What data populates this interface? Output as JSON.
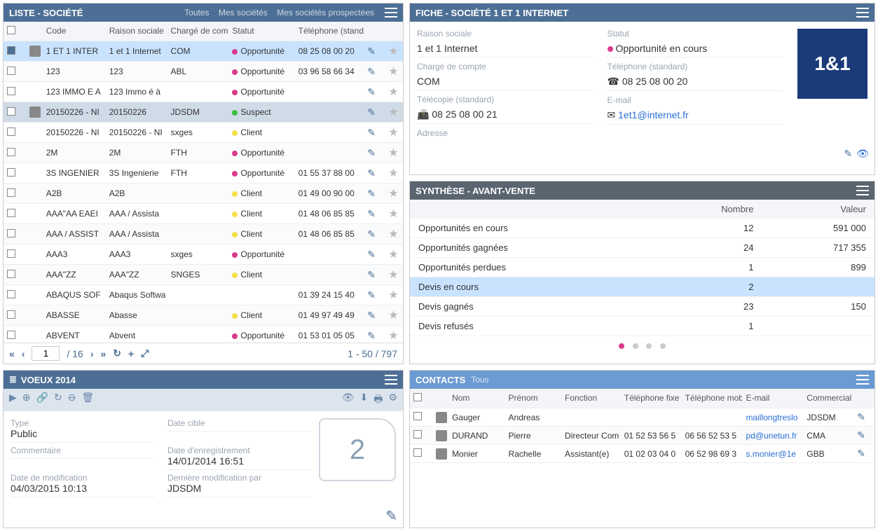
{
  "liste": {
    "title": "LISTE - SOCIÉTÉ",
    "tabs": [
      "Toutes",
      "Mes sociétés",
      "Mes sociétés prospectées"
    ],
    "headers": {
      "code": "Code",
      "raison": "Raison sociale",
      "charge": "Chargé de compte",
      "statut": "Statut",
      "tel": "Téléphone (standard)"
    },
    "rows": [
      {
        "chk": true,
        "logo": true,
        "code": "1 ET 1 INTER",
        "rs": "1 et 1 Internet",
        "cc": "COM",
        "sc": "#d93b8a",
        "stat": "Opportunité",
        "tel": "08 25 08 00 20",
        "sel": true
      },
      {
        "chk": false,
        "logo": false,
        "code": "123",
        "rs": "123",
        "cc": "ABL",
        "sc": "#d93b8a",
        "stat": "Opportunité",
        "tel": "03 96 58 66 34"
      },
      {
        "chk": false,
        "logo": false,
        "code": "123 IMMO E A",
        "rs": "123 Immo é à",
        "cc": "",
        "sc": "#d93b8a",
        "stat": "Opportunité",
        "tel": ""
      },
      {
        "chk": false,
        "logo": true,
        "code": "20150226 - NI",
        "rs": "20150226",
        "cc": "JDSDM",
        "sc": "#3cbf3c",
        "stat": "Suspect",
        "tel": "",
        "alt": true
      },
      {
        "chk": false,
        "logo": false,
        "code": "20150226 - NI",
        "rs": "20150226 - NI",
        "cc": "sxges",
        "sc": "#f5e04a",
        "stat": "Client",
        "tel": ""
      },
      {
        "chk": false,
        "logo": false,
        "code": "2M",
        "rs": "2M",
        "cc": "FTH",
        "sc": "#d93b8a",
        "stat": "Opportunité",
        "tel": ""
      },
      {
        "chk": false,
        "logo": false,
        "code": "3S INGENIER",
        "rs": "3S Ingenierie",
        "cc": "FTH",
        "sc": "#d93b8a",
        "stat": "Opportunité",
        "tel": "01 55 37 88 00"
      },
      {
        "chk": false,
        "logo": false,
        "code": "A2B",
        "rs": "A2B",
        "cc": "",
        "sc": "#f5e04a",
        "stat": "Client",
        "tel": "01 49 00 90 00"
      },
      {
        "chk": false,
        "logo": false,
        "code": "AAA\"AA EAEI",
        "rs": "AAA / Assista",
        "cc": "",
        "sc": "#f5e04a",
        "stat": "Client",
        "tel": "01 48 06 85 85"
      },
      {
        "chk": false,
        "logo": false,
        "code": "AAA / ASSIST",
        "rs": "AAA / Assista",
        "cc": "",
        "sc": "#f5e04a",
        "stat": "Client",
        "tel": "01 48 06 85 85"
      },
      {
        "chk": false,
        "logo": false,
        "code": "AAA3",
        "rs": "AAA3",
        "cc": "sxges",
        "sc": "#d93b8a",
        "stat": "Opportunité",
        "tel": ""
      },
      {
        "chk": false,
        "logo": false,
        "code": "AAA\"ZZ",
        "rs": "AAA\"ZZ",
        "cc": "SNGES",
        "sc": "#f5e04a",
        "stat": "Client",
        "tel": ""
      },
      {
        "chk": false,
        "logo": false,
        "code": "ABAQUS SOF",
        "rs": "Abaqus Softwa",
        "cc": "",
        "sc": "",
        "stat": "",
        "tel": "01 39 24 15 40"
      },
      {
        "chk": false,
        "logo": false,
        "code": "ABASSE",
        "rs": "Abasse",
        "cc": "",
        "sc": "#f5e04a",
        "stat": "Client",
        "tel": "01 49 97 49 49"
      },
      {
        "chk": false,
        "logo": false,
        "code": "ABVENT",
        "rs": "Abvent",
        "cc": "",
        "sc": "#d93b8a",
        "stat": "Opportunité",
        "tel": "01 53 01 05 05"
      }
    ],
    "pager": {
      "page": "1",
      "totalpages": "/ 16",
      "range": "1 - 50 / 797"
    }
  },
  "voeux": {
    "title": "VOEUX 2014",
    "count": "2",
    "labels": {
      "type": "Type",
      "datecible": "Date cible",
      "comm": "Commentaire",
      "dateenr": "Date d'enregistrement",
      "datemod": "Date de modification",
      "lastmod": "Dernière modification par"
    },
    "vals": {
      "type": "Public",
      "datecible": "",
      "comm": "",
      "dateenr": "14/01/2014 16:51",
      "datemod": "04/03/2015 10:13",
      "lastmod": "JDSDM"
    }
  },
  "fiche": {
    "title": "FICHE - SOCIÉTÉ 1 ET 1 INTERNET",
    "logo": "1&1",
    "labels": {
      "rs": "Raison sociale",
      "stat": "Statut",
      "cc": "Chargé de compte",
      "tel": "Téléphone (standard)",
      "fax": "Télécopie (standard)",
      "email": "E-mail",
      "addr": "Adresse"
    },
    "vals": {
      "rs": "1 et 1 Internet",
      "stat": "Opportunité en cours",
      "cc": "COM",
      "tel": "08 25 08 00 20",
      "fax": "08 25 08 00 21",
      "email": "1et1@internet.fr"
    },
    "statcolor": "#d93b8a"
  },
  "synth": {
    "title": "SYNTHÈSE - AVANT-VENTE",
    "headers": {
      "label": "",
      "nombre": "Nombre",
      "valeur": "Valeur"
    },
    "rows": [
      {
        "label": "Opportunités en cours",
        "n": "12",
        "v": "591 000"
      },
      {
        "label": "Opportunités gagnées",
        "n": "24",
        "v": "717 355"
      },
      {
        "label": "Opportunités perdues",
        "n": "1",
        "v": "899"
      },
      {
        "label": "Devis en cours",
        "n": "2",
        "v": "",
        "hl": true
      },
      {
        "label": "Devis gagnés",
        "n": "23",
        "v": "150"
      },
      {
        "label": "Devis refusés",
        "n": "1",
        "v": ""
      }
    ]
  },
  "contacts": {
    "title": "CONTACTS",
    "sub": "Tous",
    "headers": {
      "nom": "Nom",
      "prenom": "Prénom",
      "fonction": "Fonction",
      "telfixe": "Téléphone fixe",
      "telmob": "Téléphone mobile",
      "email": "E-mail",
      "com": "Commercial"
    },
    "rows": [
      {
        "nom": "Gauger",
        "prenom": "Andreas",
        "fonction": "",
        "tf": "",
        "tm": "",
        "em": "maillongtreslo",
        "com": "JDSDM"
      },
      {
        "nom": "DURAND",
        "prenom": "Pierre",
        "fonction": "Directeur Com",
        "tf": "01 52 53 56 5",
        "tm": "06 56 52 53 5",
        "em": "pd@unetun.fr",
        "com": "CMA"
      },
      {
        "nom": "Monier",
        "prenom": "Rachelle",
        "fonction": "Assistant(e)",
        "tf": "01 02 03 04 0",
        "tm": "06 52 98 69 3",
        "em": "s.monier@1e",
        "com": "GBB"
      }
    ]
  }
}
